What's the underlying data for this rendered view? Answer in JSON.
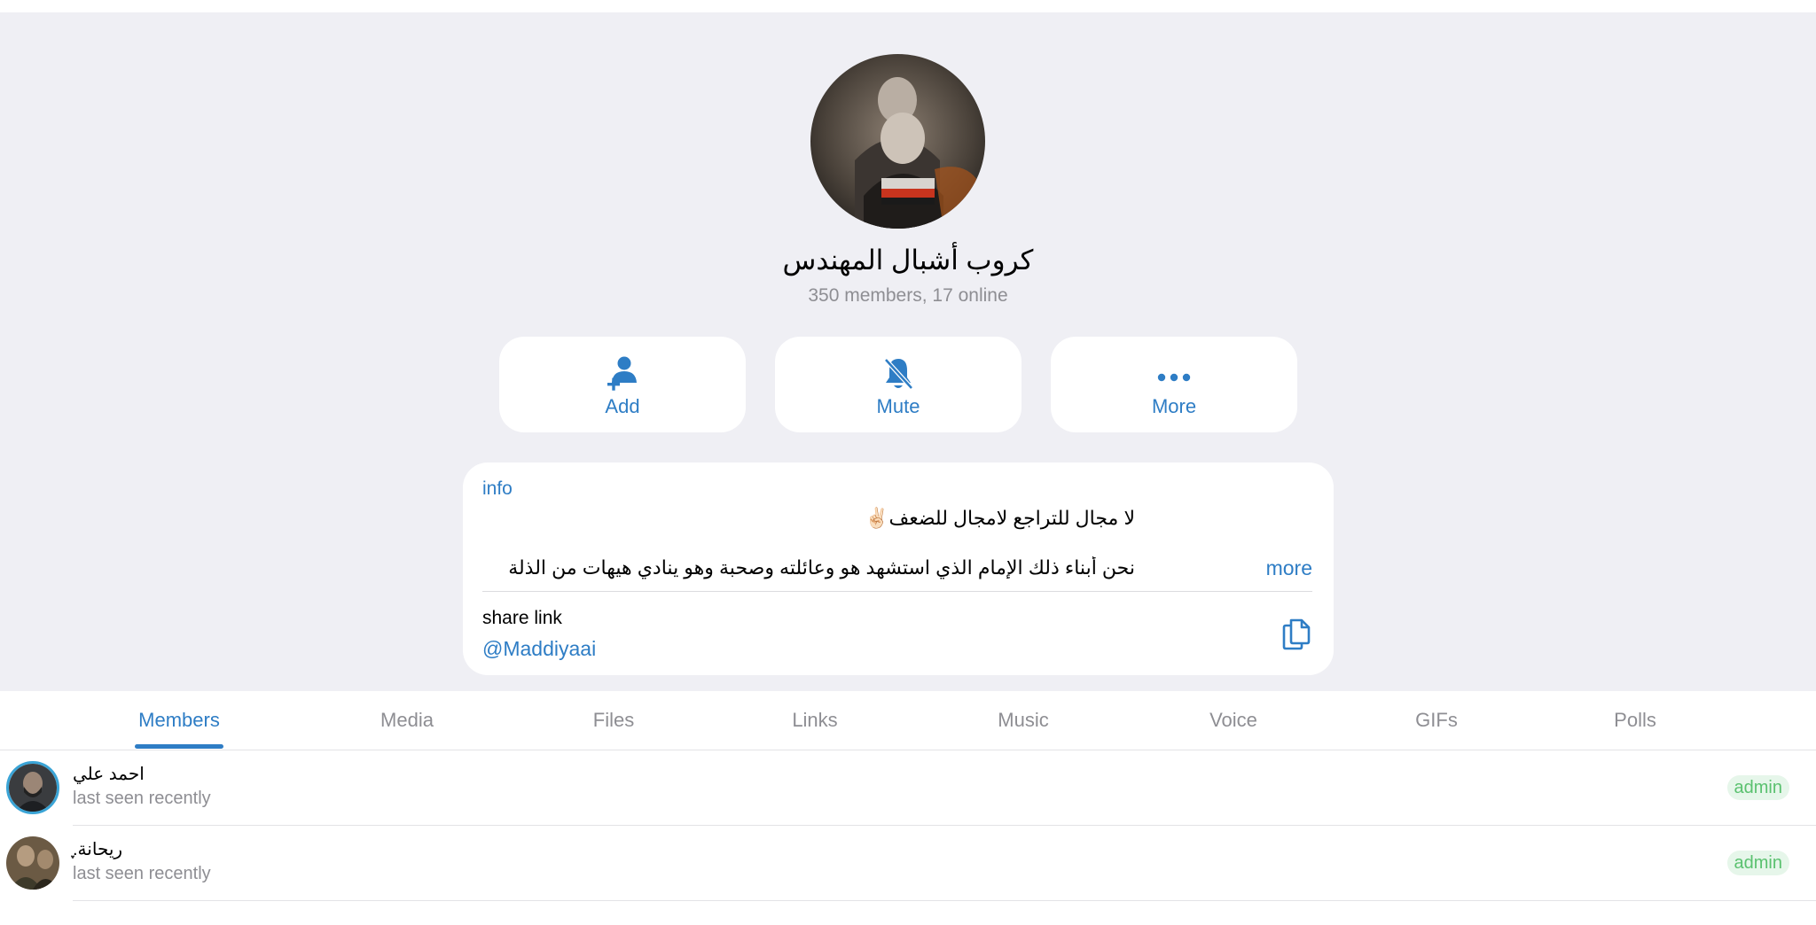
{
  "group": {
    "name": "كروب أشبال المهندس",
    "subtitle": "350 members, 17 online"
  },
  "actions": [
    {
      "label": "Add",
      "icon": "add-user-icon"
    },
    {
      "label": "Mute",
      "icon": "mute-bell-icon"
    },
    {
      "label": "More",
      "icon": "more-dots-icon"
    }
  ],
  "info": {
    "label": "info",
    "line1": "لا مجال للتراجع لامجال للضعف✌🏻",
    "line2": "نحن أبناء ذلك الإمام الذي استشهد هو وعائلته وصحبة وهو ينادي هيهات من الذلة",
    "more": "more",
    "share_label": "share link",
    "share_value": "@Maddiyaai"
  },
  "tabs": [
    {
      "label": "Members",
      "active": true
    },
    {
      "label": "Media"
    },
    {
      "label": "Files"
    },
    {
      "label": "Links"
    },
    {
      "label": "Music"
    },
    {
      "label": "Voice"
    },
    {
      "label": "GIFs"
    },
    {
      "label": "Polls"
    }
  ],
  "members": [
    {
      "name": "احمد علي",
      "status": "last seen recently",
      "badge": "admin"
    },
    {
      "name": "ريحانة.ֶָ",
      "status": "last seen recently",
      "badge": "admin"
    }
  ],
  "colors": {
    "accent": "#2e7dc5",
    "header_bg": "#efeff4",
    "admin_badge_bg": "#e6f6ea",
    "admin_badge_text": "#5ac16f"
  }
}
